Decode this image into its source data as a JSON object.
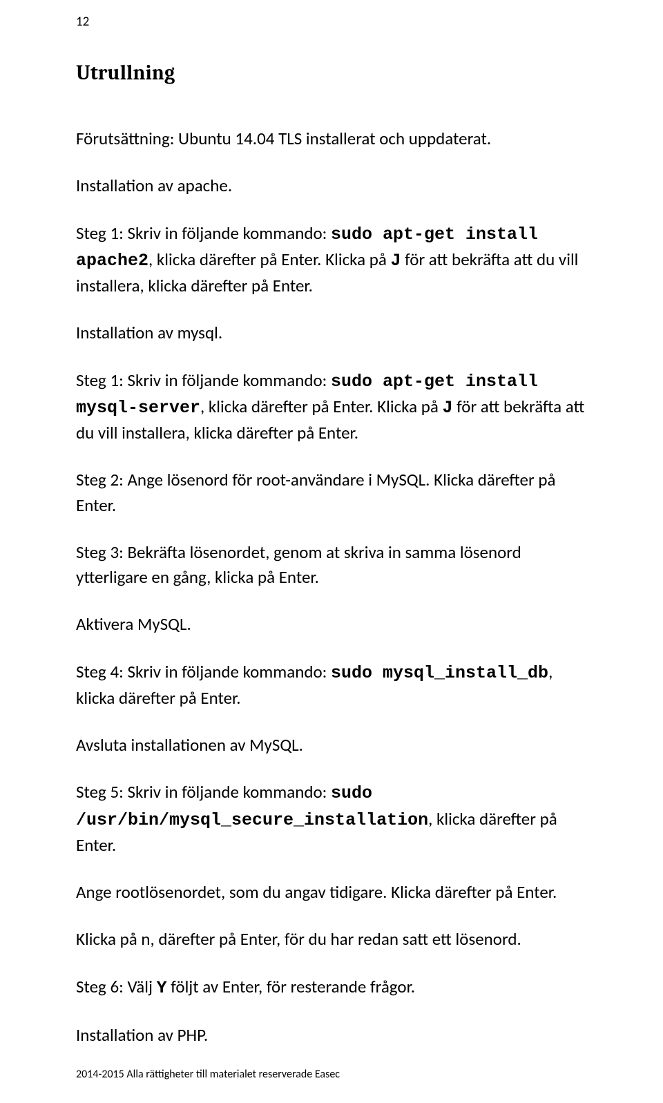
{
  "page_number": "12",
  "title": "Utrullning",
  "paragraphs": {
    "p1": "Förutsättning: Ubuntu 14.04 TLS installerat och uppdaterat.",
    "p2": "Installation av apache.",
    "p3a": "Steg 1: Skriv in följande kommando: ",
    "p3_cmd": "sudo apt-get install apache2",
    "p3b": ", klicka därefter på Enter. Klicka på ",
    "p3_key": "J",
    "p3c": " för att bekräfta att du vill installera, klicka därefter på Enter.",
    "p4": "Installation av mysql.",
    "p5a": "Steg 1: Skriv in följande kommando: ",
    "p5_cmd": "sudo apt-get install mysql-server",
    "p5b": ", klicka därefter på Enter. Klicka på ",
    "p5_key": "J",
    "p5c": " för att bekräfta att du vill installera, klicka därefter på Enter.",
    "p6": "Steg 2: Ange lösenord för root-användare i MySQL. Klicka därefter på Enter.",
    "p7": "Steg 3: Bekräfta lösenordet, genom at skriva in samma lösenord ytterligare en gång, klicka på Enter.",
    "p8": "Aktivera MySQL.",
    "p9a": "Steg 4: Skriv in följande kommando: ",
    "p9_cmd": "sudo mysql_install_db",
    "p9b": ", klicka därefter på Enter.",
    "p10": "Avsluta installationen av MySQL.",
    "p11a": "Steg 5: Skriv in följande kommando: ",
    "p11_cmd": "sudo /usr/bin/mysql_secure_installation",
    "p11b": ", klicka därefter på Enter.",
    "p12": "Ange rootlösenordet, som du angav tidigare. Klicka därefter på Enter.",
    "p13": "Klicka på n, därefter på Enter, för du har redan satt ett lösenord.",
    "p14a": "Steg 6: Välj ",
    "p14_key": "Y",
    "p14b": " följt av Enter, för resterande frågor.",
    "p15": "Installation av PHP."
  },
  "footer": "2014-2015 Alla rättigheter till materialet reserverade Easec"
}
